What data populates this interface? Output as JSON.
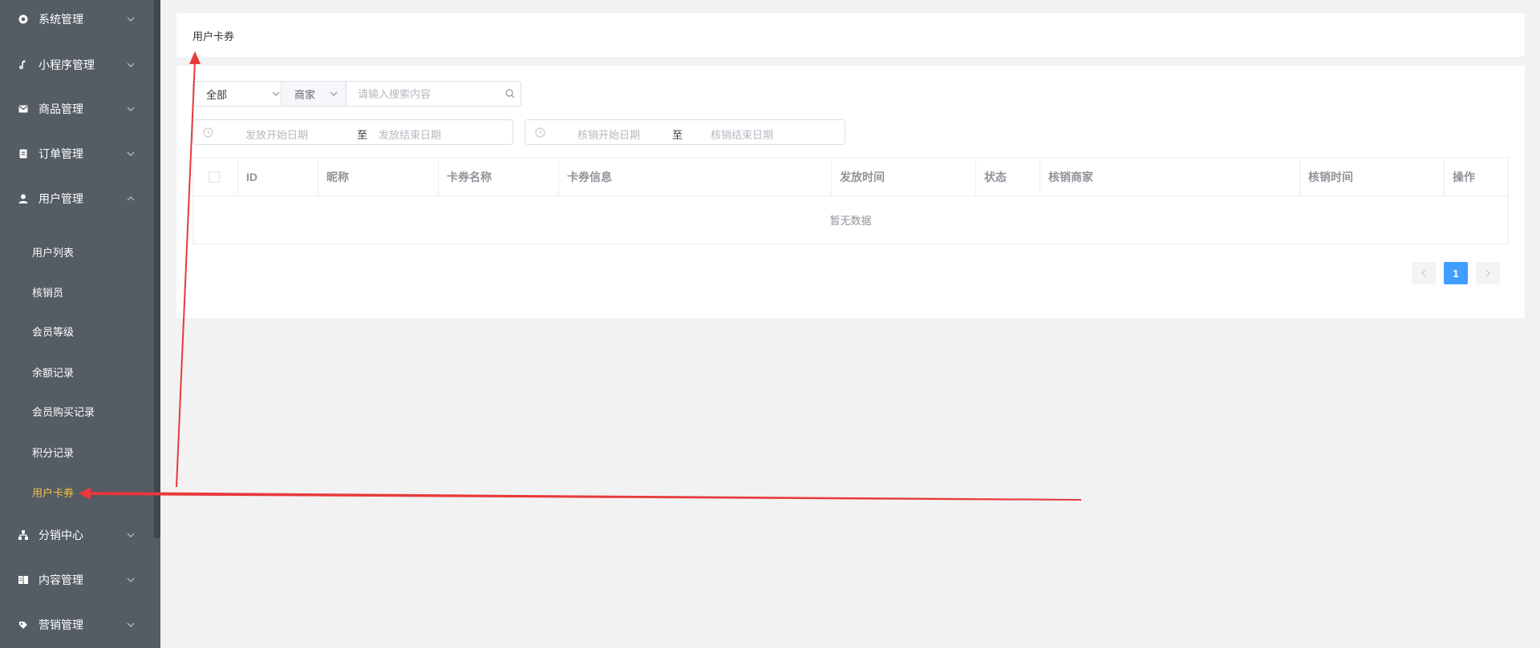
{
  "sidebar": {
    "menus": [
      {
        "label": "系统管理",
        "icon": "settings-icon"
      },
      {
        "label": "小程序管理",
        "icon": "mini-program-icon"
      },
      {
        "label": "商品管理",
        "icon": "goods-icon"
      },
      {
        "label": "订单管理",
        "icon": "order-icon"
      },
      {
        "label": "用户管理",
        "icon": "user-icon"
      },
      {
        "label": "分销中心",
        "icon": "distribution-icon"
      },
      {
        "label": "内容管理",
        "icon": "content-icon"
      },
      {
        "label": "营销管理",
        "icon": "marketing-icon"
      }
    ],
    "user_submenu": [
      {
        "label": "用户列表"
      },
      {
        "label": "核销员"
      },
      {
        "label": "会员等级"
      },
      {
        "label": "余额记录"
      },
      {
        "label": "会员购买记录"
      },
      {
        "label": "积分记录"
      },
      {
        "label": "用户卡券",
        "active": true
      }
    ]
  },
  "header": {
    "title": "用户卡券"
  },
  "filters": {
    "status_select": "全部",
    "search_type": "商家",
    "search_placeholder": "请输入搜索内容",
    "issue_range": {
      "start_placeholder": "发放开始日期",
      "separator": "至",
      "end_placeholder": "发放结束日期"
    },
    "verify_range": {
      "start_placeholder": "核销开始日期",
      "separator": "至",
      "end_placeholder": "核销结束日期"
    }
  },
  "table": {
    "columns": [
      "ID",
      "昵称",
      "卡券名称",
      "卡券信息",
      "发放时间",
      "状态",
      "核销商家",
      "核销时间",
      "操作"
    ],
    "empty_text": "暂无数据"
  },
  "pagination": {
    "current_page": "1"
  },
  "colors": {
    "sidebar_bg": "#545c64",
    "active_submenu": "#f5c542",
    "primary": "#409eff",
    "annotation_arrow": "#e8393b"
  }
}
